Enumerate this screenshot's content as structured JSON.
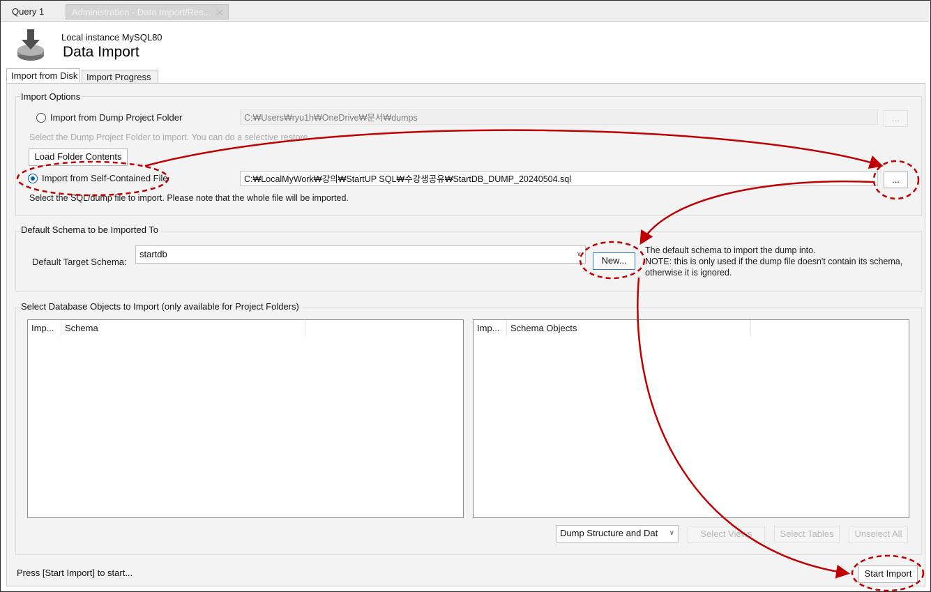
{
  "doc_tabs": {
    "query": "Query 1",
    "admin": "Administration - Data Import/Res..."
  },
  "header": {
    "instance": "Local instance MySQL80",
    "title": "Data Import"
  },
  "sub_tabs": {
    "active": "Import from Disk",
    "inactive": "Import Progress"
  },
  "import_options": {
    "title": "Import Options",
    "folder_option_label": "Import from Dump Project Folder",
    "folder_path": "C:₩Users₩ryu1h₩OneDrive₩문서₩dumps",
    "folder_browse": "...",
    "folder_hint": "Select the Dump Project Folder to import. You can do a selective restore.",
    "load_button": "Load Folder Contents",
    "file_option_label": "Import from Self-Contained File",
    "file_path": "C:₩LocalMyWork₩강의₩StartUP SQL₩수강생공유₩StartDB_DUMP_20240504.sql",
    "file_browse": "...",
    "file_hint": "Select the SQL/dump file to import. Please note that the whole file will be imported."
  },
  "default_schema": {
    "title": "Default Schema to be Imported To",
    "label": "Default Target Schema:",
    "value": "startdb",
    "new_button": "New...",
    "note_line1": "The default schema to import the dump into.",
    "note_line2": "NOTE: this is only used if the dump file doesn't contain its schema,",
    "note_line3": "otherwise it is ignored."
  },
  "db_objects": {
    "title": "Select Database Objects to Import (only available for Project Folders)",
    "left_columns": [
      "Imp...",
      "Schema"
    ],
    "right_columns": [
      "Imp...",
      "Schema Objects"
    ],
    "dump_select": "Dump Structure and Dat",
    "select_views": "Select Views",
    "select_tables": "Select Tables",
    "unselect_all": "Unselect All"
  },
  "status_text": "Press [Start Import] to start...",
  "start_button": "Start Import",
  "colors": {
    "annotation": "#c00000",
    "radio_selected": "#005fb8"
  },
  "icons": {
    "db_import": "database-import-icon",
    "combo": "chevron-down-icon",
    "close": "close-icon"
  }
}
